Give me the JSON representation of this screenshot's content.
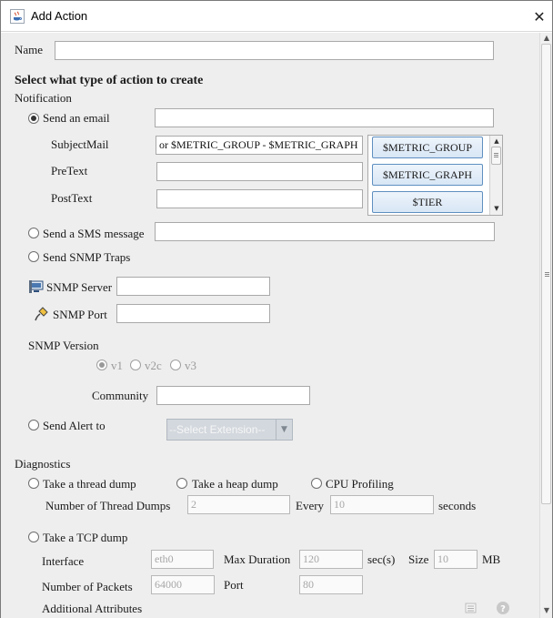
{
  "window": {
    "title": "Add Action"
  },
  "name_field": {
    "label": "Name",
    "value": ""
  },
  "section_title": "Select what type of action to create",
  "notification": {
    "heading": "Notification",
    "email": {
      "label": "Send an email",
      "checked": true,
      "value": "",
      "subject_label": "SubjectMail",
      "subject_value": "or $METRIC_GROUP - $METRIC_GRAPH",
      "pretext_label": "PreText",
      "pretext_value": "",
      "posttext_label": "PostText",
      "posttext_value": "",
      "macro_buttons": [
        "$METRIC_GROUP",
        "$METRIC_GRAPH",
        "$TIER"
      ]
    },
    "sms": {
      "label": "Send a SMS message",
      "value": ""
    },
    "snmp": {
      "label": "Send SNMP Traps",
      "server_label": "SNMP Server",
      "server_value": "",
      "port_label": "SNMP Port",
      "port_value": "",
      "version_label": "SNMP Version",
      "versions": [
        "v1",
        "v2c",
        "v3"
      ],
      "selected_version": "v1",
      "community_label": "Community",
      "community_value": ""
    },
    "alert": {
      "label": "Send Alert to",
      "extension_value": "--Select Extension--"
    }
  },
  "diagnostics": {
    "heading": "Diagnostics",
    "thread_dump": {
      "label": "Take a thread dump",
      "count_label": "Number of Thread Dumps",
      "count_value": "2",
      "every_label": "Every",
      "every_value": "10",
      "seconds_label": "seconds"
    },
    "heap_dump": {
      "label": "Take a heap dump"
    },
    "cpu_profiling": {
      "label": "CPU Profiling"
    },
    "tcp_dump": {
      "label": "Take a TCP dump",
      "interface_label": "Interface",
      "interface_value": "eth0",
      "max_duration_label": "Max Duration",
      "max_duration_value": "120",
      "secs_label": "sec(s)",
      "size_label": "Size",
      "size_value": "10",
      "mb_label": "MB",
      "packets_label": "Number of Packets",
      "packets_value": "64000",
      "port_label": "Port",
      "port_value": "80",
      "additional_label": "Additional Attributes"
    }
  },
  "icons": {
    "app": "java-coffee-icon",
    "close": "close-icon",
    "snmp_server": "server-monitor-icon",
    "snmp_port": "plug-icon",
    "list": "list-icon",
    "help": "help-icon"
  },
  "colors": {
    "accent_border": "#5f8fc0",
    "panel_bg": "#eeeeee",
    "disabled_text": "#a6a6a6"
  }
}
